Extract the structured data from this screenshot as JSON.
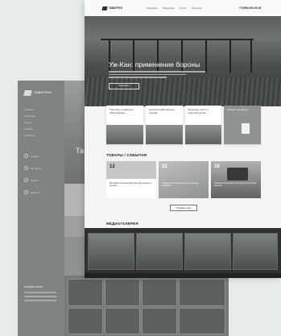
{
  "back": {
    "logo_text": "ТАВАТРУК",
    "nav": [
      "Главная",
      "Компания",
      "Услуги",
      "Техника",
      "Контакты"
    ],
    "icon_items": [
      "Сервис",
      "Запчасти",
      "Лизинг",
      "Новости"
    ],
    "side_title": "ПОДПИСАТЬСЯ",
    "hero_title": "Та"
  },
  "front": {
    "logo_text": "ТАВАТРУК",
    "nav": [
      "Компания",
      "Продукция",
      "Услуги",
      "Контакты"
    ],
    "phone": "+7(000) 000-00-00",
    "hero": {
      "title": "Уж-Кан: применение бороны",
      "button": "Подробнее"
    },
    "cards": [
      {
        "title": "Тракторы и навесное оборудование"
      },
      {
        "title": "Сельскохозяйственная техника"
      },
      {
        "title": "Запасные части и комплектующие"
      },
      {
        "title": "Каталог продукции"
      }
    ],
    "news_title": "ТОВАРЫ / СОБЫТИЯ",
    "news": [
      {
        "date": "12",
        "text": "Выставка сельскохозяйственной техники в регионе"
      },
      {
        "date": "22",
        "text": "Новые поступления техники на склад компании"
      },
      {
        "date": "18",
        "text": "Полевые испытания тракторов на опытном участке"
      }
    ],
    "more_button": "Показать еще",
    "gallery_title": "МЕДИАГАЛЕРЕЯ"
  }
}
